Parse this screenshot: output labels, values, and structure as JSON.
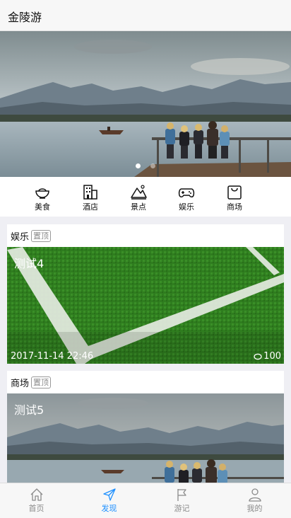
{
  "header": {
    "title": "金陵游"
  },
  "banner": {
    "dots": 2,
    "active_dot": 0
  },
  "categories": [
    {
      "label": "美食",
      "icon": "bowl-icon"
    },
    {
      "label": "酒店",
      "icon": "building-icon"
    },
    {
      "label": "景点",
      "icon": "mountain-icon"
    },
    {
      "label": "娱乐",
      "icon": "gamepad-icon"
    },
    {
      "label": "商场",
      "icon": "shopping-bag-icon"
    }
  ],
  "feed": [
    {
      "type": "娱乐",
      "pin": "置顶",
      "title": "测试4",
      "date": "2017-11-14 22:46",
      "comments": "100"
    },
    {
      "type": "商场",
      "pin": "置顶",
      "title": "测试5"
    }
  ],
  "tabbar": [
    {
      "label": "首页",
      "icon": "home-icon"
    },
    {
      "label": "发现",
      "icon": "paper-plane-icon",
      "active": true
    },
    {
      "label": "游记",
      "icon": "flag-icon"
    },
    {
      "label": "我的",
      "icon": "user-icon"
    }
  ],
  "colors": {
    "accent": "#1e90ff"
  }
}
